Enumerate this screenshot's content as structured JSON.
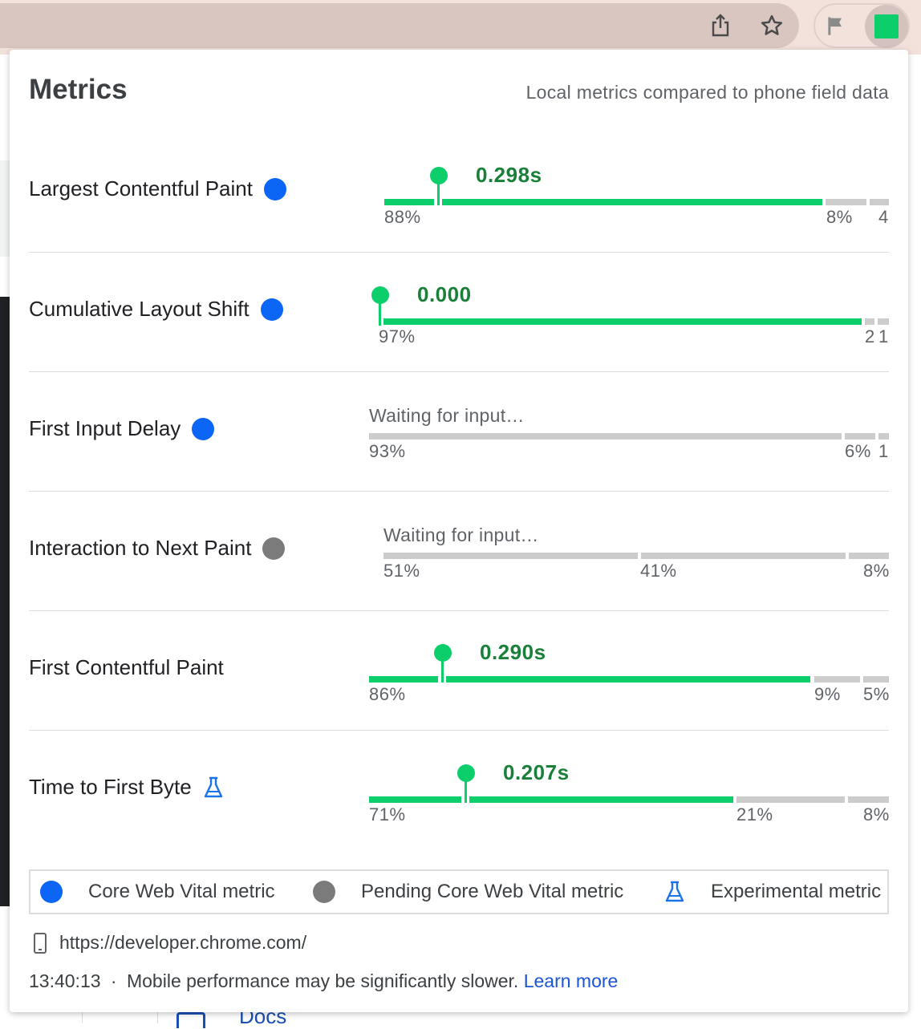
{
  "popup": {
    "title": "Metrics",
    "subtitle": "Local metrics compared to phone field data"
  },
  "colors": {
    "good": "#0cce6b",
    "good_text": "#188038",
    "neutral_bar": "#cccccc",
    "core_dot": "#0b65f5",
    "pending_dot": "#7b7b7b"
  },
  "metrics": [
    {
      "label": "Largest Contentful Paint",
      "badge": "core",
      "status": "0.298s",
      "distribution": [
        "88%",
        "8%",
        "4"
      ],
      "active_segment": 0,
      "marker_position": 0.12
    },
    {
      "label": "Cumulative Layout Shift",
      "badge": "core",
      "status": "0.000",
      "distribution": [
        "97%",
        "2",
        "1"
      ],
      "active_segment": 0,
      "marker_position": 0.0
    },
    {
      "label": "First Input Delay",
      "badge": "core",
      "status": "Waiting for input…",
      "distribution": [
        "93%",
        "6%",
        "1"
      ],
      "active_segment": null
    },
    {
      "label": "Interaction to Next Paint",
      "badge": "pending",
      "status": "Waiting for input…",
      "distribution": [
        "51%",
        "41%",
        "8%"
      ],
      "active_segment": null
    },
    {
      "label": "First Contentful Paint",
      "badge": null,
      "status": "0.290s",
      "distribution": [
        "86%",
        "9%",
        "5%"
      ],
      "active_segment": 0,
      "marker_position": 0.15
    },
    {
      "label": "Time to First Byte",
      "badge": "experimental",
      "status": "0.207s",
      "distribution": [
        "71%",
        "21%",
        "8%"
      ],
      "active_segment": 0,
      "marker_position": 0.26
    }
  ],
  "legend": {
    "core": "Core Web Vital metric",
    "pending": "Pending Core Web Vital metric",
    "experimental": "Experimental metric"
  },
  "footer": {
    "url": "https://developer.chrome.com/",
    "time": "13:40:13",
    "separator": "·",
    "note": "Mobile performance may be significantly slower.",
    "learn_more": "Learn more"
  },
  "background": {
    "docs_label": "Docs"
  },
  "icons": {
    "share": "share-icon",
    "star": "star-icon",
    "flag": "flag-icon",
    "extension": "web-vitals-extension-icon"
  }
}
